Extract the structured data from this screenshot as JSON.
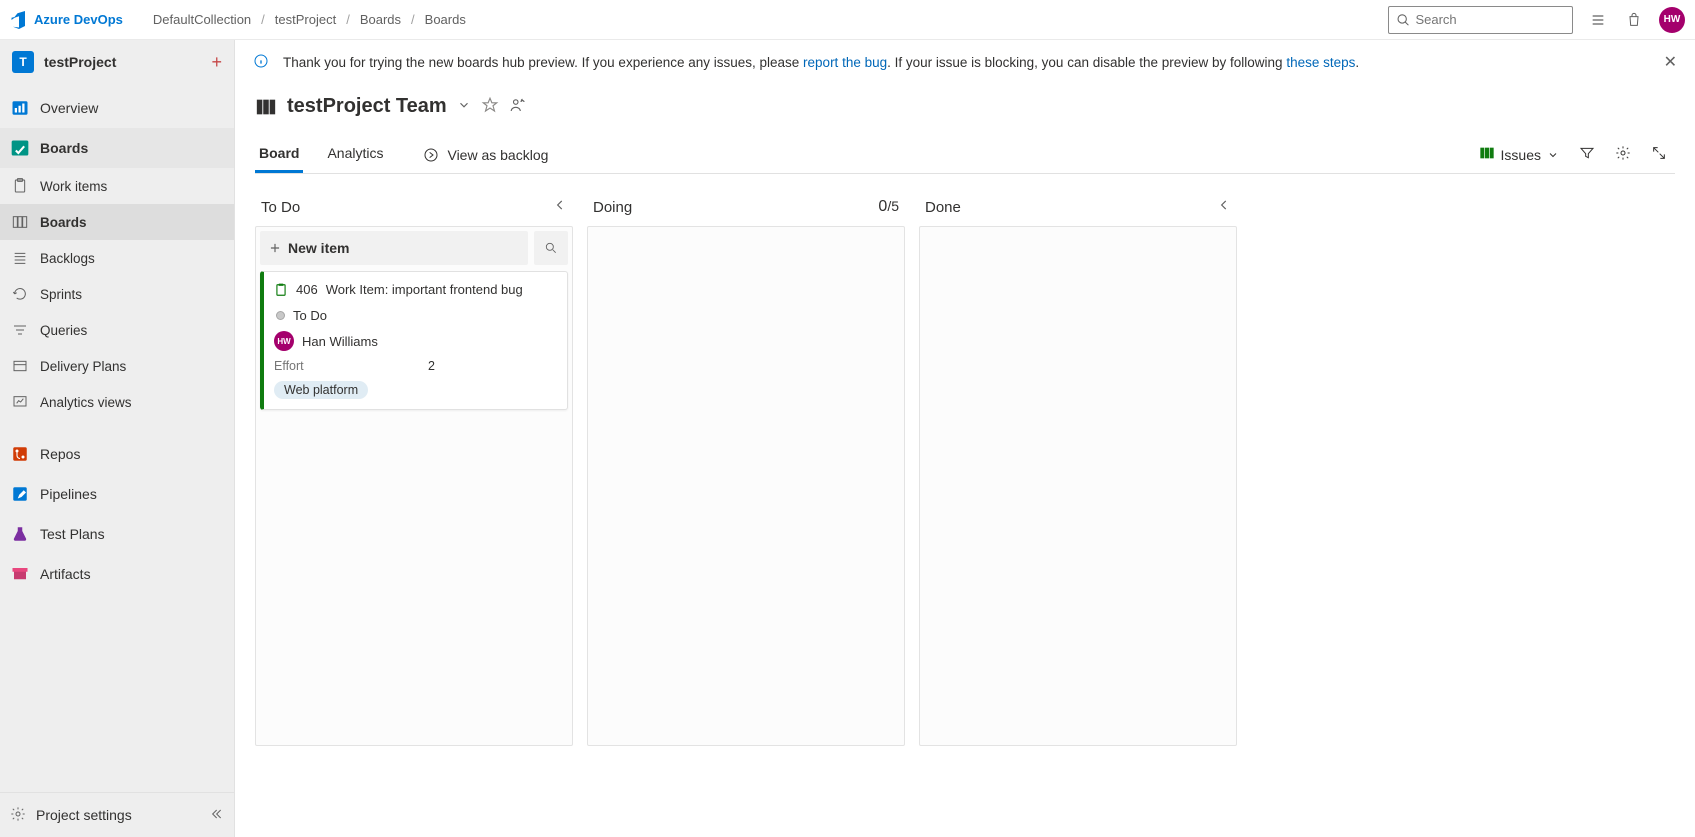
{
  "brand": {
    "name": "Azure DevOps"
  },
  "breadcrumbs": [
    "DefaultCollection",
    "testProject",
    "Boards",
    "Boards"
  ],
  "search": {
    "placeholder": "Search"
  },
  "avatar": {
    "initials": "HW"
  },
  "sidebar": {
    "project": {
      "initial": "T",
      "name": "testProject"
    },
    "overview": "Overview",
    "boards": "Boards",
    "boards_sub": {
      "work_items": "Work items",
      "boards": "Boards",
      "backlogs": "Backlogs",
      "sprints": "Sprints",
      "queries": "Queries",
      "delivery_plans": "Delivery Plans",
      "analytics_views": "Analytics views"
    },
    "repos": "Repos",
    "pipelines": "Pipelines",
    "test_plans": "Test Plans",
    "artifacts": "Artifacts",
    "project_settings": "Project settings"
  },
  "banner": {
    "text1": "Thank you for trying the new boards hub preview. If you experience any issues, please ",
    "link1": "report the bug",
    "text2": ". If your issue is blocking, you can disable the preview by following ",
    "link2": "these steps",
    "text3": "."
  },
  "header": {
    "team": "testProject Team",
    "tabs": {
      "board": "Board",
      "analytics": "Analytics",
      "backlog": "View as backlog"
    },
    "issues_label": "Issues"
  },
  "columns": {
    "todo": {
      "title": "To Do",
      "new_item": "New item"
    },
    "doing": {
      "title": "Doing",
      "count": "0",
      "limit": "/5"
    },
    "done": {
      "title": "Done"
    }
  },
  "card": {
    "id": "406",
    "title": "Work Item: important frontend bug",
    "state": "To Do",
    "assignee": "Han Williams",
    "assignee_initials": "HW",
    "effort_label": "Effort",
    "effort_value": "2",
    "tag": "Web platform"
  }
}
